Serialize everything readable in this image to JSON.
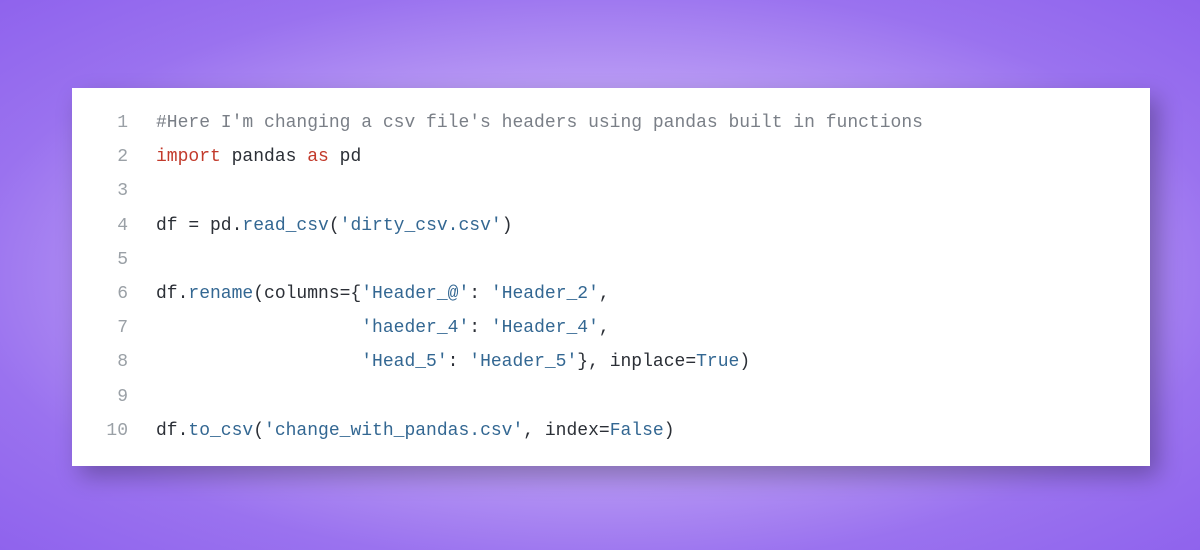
{
  "colors": {
    "background_center": "#ffffff",
    "background_edge": "#9a72ef",
    "card_bg": "#ffffff",
    "shadow": "rgba(0,0,0,0.28)",
    "line_number": "#9aa0a6",
    "comment": "#7a7f87",
    "default": "#2b2f36",
    "keyword_red": "#c23a2b",
    "keyword_green": "#2e8b57",
    "call_blue": "#336792"
  },
  "code": {
    "language": "python",
    "lines": [
      {
        "n": "1",
        "tokens": [
          {
            "c": "tok-comment",
            "t": "#Here I'm changing a csv file's headers using pandas built in functions"
          }
        ]
      },
      {
        "n": "2",
        "tokens": [
          {
            "c": "tok-red",
            "t": "import"
          },
          {
            "c": "tok-default",
            "t": " pandas "
          },
          {
            "c": "tok-red",
            "t": "as"
          },
          {
            "c": "tok-default",
            "t": " pd"
          }
        ]
      },
      {
        "n": "3",
        "tokens": [
          {
            "c": "tok-default",
            "t": ""
          }
        ]
      },
      {
        "n": "4",
        "tokens": [
          {
            "c": "tok-default",
            "t": "df = pd."
          },
          {
            "c": "tok-call",
            "t": "read_csv"
          },
          {
            "c": "tok-default",
            "t": "("
          },
          {
            "c": "tok-str",
            "t": "'dirty_csv.csv'"
          },
          {
            "c": "tok-default",
            "t": ")"
          }
        ]
      },
      {
        "n": "5",
        "tokens": [
          {
            "c": "tok-default",
            "t": ""
          }
        ]
      },
      {
        "n": "6",
        "tokens": [
          {
            "c": "tok-default",
            "t": "df."
          },
          {
            "c": "tok-call",
            "t": "rename"
          },
          {
            "c": "tok-default",
            "t": "(columns={"
          },
          {
            "c": "tok-str",
            "t": "'Header_@'"
          },
          {
            "c": "tok-default",
            "t": ": "
          },
          {
            "c": "tok-str",
            "t": "'Header_2'"
          },
          {
            "c": "tok-default",
            "t": ","
          }
        ]
      },
      {
        "n": "7",
        "tokens": [
          {
            "c": "tok-default",
            "t": "                   "
          },
          {
            "c": "tok-str",
            "t": "'haeder_4'"
          },
          {
            "c": "tok-default",
            "t": ": "
          },
          {
            "c": "tok-str",
            "t": "'Header_4'"
          },
          {
            "c": "tok-default",
            "t": ","
          }
        ]
      },
      {
        "n": "8",
        "tokens": [
          {
            "c": "tok-default",
            "t": "                   "
          },
          {
            "c": "tok-str",
            "t": "'Head_5'"
          },
          {
            "c": "tok-default",
            "t": ": "
          },
          {
            "c": "tok-str",
            "t": "'Header_5'"
          },
          {
            "c": "tok-default",
            "t": "}, inplace="
          },
          {
            "c": "tok-bool",
            "t": "True"
          },
          {
            "c": "tok-default",
            "t": ")"
          }
        ]
      },
      {
        "n": "9",
        "tokens": [
          {
            "c": "tok-default",
            "t": ""
          }
        ]
      },
      {
        "n": "10",
        "tokens": [
          {
            "c": "tok-default",
            "t": "df."
          },
          {
            "c": "tok-call",
            "t": "to_csv"
          },
          {
            "c": "tok-default",
            "t": "("
          },
          {
            "c": "tok-str",
            "t": "'change_with_pandas.csv'"
          },
          {
            "c": "tok-default",
            "t": ", index="
          },
          {
            "c": "tok-bool",
            "t": "False"
          },
          {
            "c": "tok-default",
            "t": ")"
          }
        ]
      }
    ]
  }
}
